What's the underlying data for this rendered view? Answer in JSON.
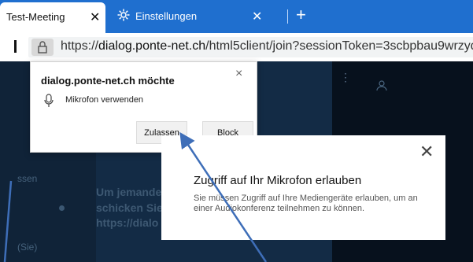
{
  "tabs": {
    "active": {
      "title": "Test-Meeting",
      "close": "✕"
    },
    "inactive": {
      "title": "Einstellungen",
      "close": "✕"
    },
    "new_tab": "+"
  },
  "address_bar": {
    "prefix": "https://",
    "domain": "dialog.ponte-net.ch",
    "path": "/html5client/join?sessionToken=3scbpbau9wrzyq"
  },
  "permission_popup": {
    "title": "dialog.ponte-net.ch möchte",
    "close": "×",
    "request_label": "Mikrofon verwenden",
    "icon": "microphone-icon",
    "allow_label": "Zulassen",
    "block_label": "Block"
  },
  "info_dialog": {
    "close": "✕",
    "heading": "Zugriff auf Ihr Mikrofon erlauben",
    "description": "Sie müssen Zugriff auf Ihre Mediengeräte erlauben, um an einer Audiokonferenz teilnehmen zu können."
  },
  "background": {
    "left_label_1": "ssen",
    "left_label_2": "(Sie)",
    "text_line_1": "Um jemande",
    "text_line_2": "schicken Sie",
    "text_line_3": "https://dialo"
  },
  "colors": {
    "tab_strip": "#1f6fcf",
    "app_background": "#06172b",
    "arrow": "#3e6eb8"
  }
}
